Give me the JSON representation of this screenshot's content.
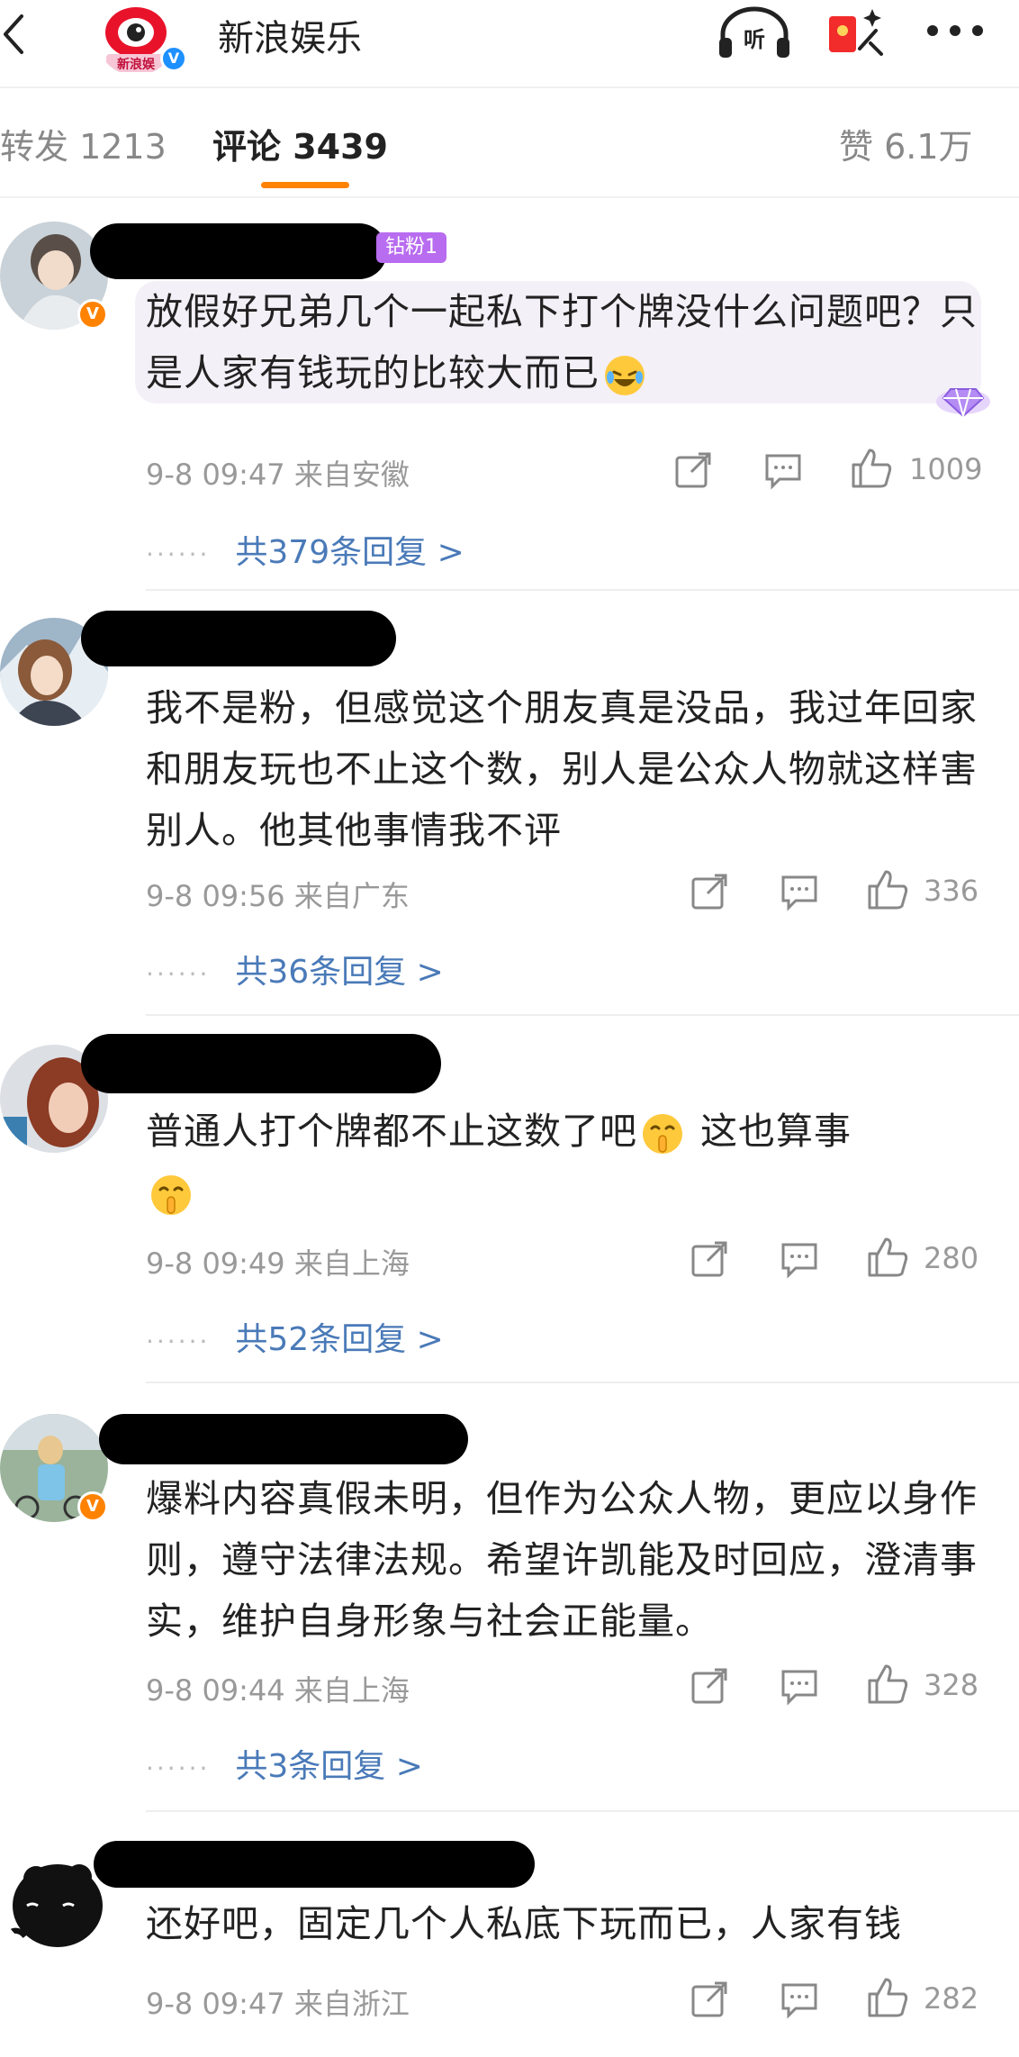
{
  "header": {
    "account_name": "新浪娱乐",
    "verified_mark": "V",
    "icons": [
      "back-icon",
      "listen-icon",
      "red-packet-icon",
      "more-icon"
    ]
  },
  "tabs": {
    "repost": "转发 1213",
    "comments": "评论 3439",
    "likes": "赞 6.1万"
  },
  "accent_color": "#ff8200",
  "link_color": "#4a7ab8",
  "comments": [
    {
      "fan_badge": "钻粉1",
      "text": "放假好兄弟几个一起私下打个牌没什么问题吧？只是人家有钱玩的比较大而已",
      "time": "9-8 09:47 来自安徽",
      "likes": "1009",
      "replies": "共379条回复 >",
      "verified": "V"
    },
    {
      "text": "我不是粉，但感觉这个朋友真是没品，我过年回家和朋友玩也不止这个数，别人是公众人物就这样害别人。他其他事情我不评",
      "time": "9-8 09:56 来自广东",
      "likes": "336",
      "replies": "共36条回复 >"
    },
    {
      "text": "普通人打个牌都不止这数了吧",
      "text2": "这也算事",
      "time": "9-8 09:49 来自上海",
      "likes": "280",
      "replies": "共52条回复 >"
    },
    {
      "text": "爆料内容真假未明，但作为公众人物，更应以身作则，遵守法律法规。希望许凯能及时回应，澄清事实，维护自身形象与社会正能量。",
      "time": "9-8 09:44 来自上海",
      "likes": "328",
      "replies": "共3条回复 >",
      "verified": "V"
    },
    {
      "text": "还好吧，固定几个人私底下玩而已，人家有钱",
      "time": "9-8 09:47 来自浙江",
      "likes": "282"
    }
  ]
}
